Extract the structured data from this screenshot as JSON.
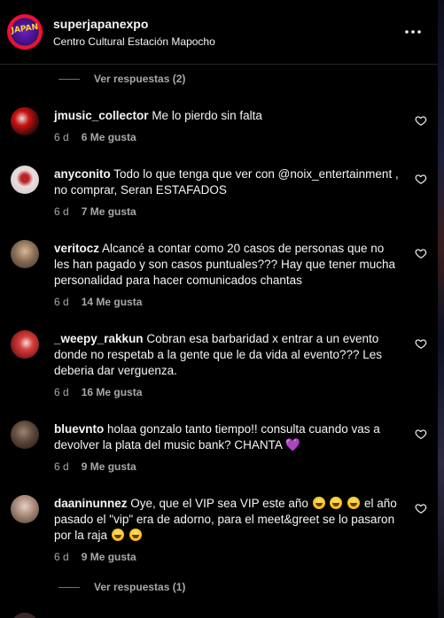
{
  "header": {
    "username": "superjapanexpo",
    "location": "Centro Cultural Estación Mapocho",
    "logo_text": "JAPAN",
    "more_icon": "more-horizontal-icon"
  },
  "replies_top": {
    "label": "Ver respuestas (2)"
  },
  "replies_bottom": {
    "label": "Ver respuestas (1)"
  },
  "comments": [
    {
      "username": "jmusic_collector",
      "text": "Me lo pierdo sin falta",
      "age": "6 d",
      "likes": "6 Me gusta",
      "avatar_color": "#5a1010"
    },
    {
      "username": "anyconito",
      "text": "Todo lo que tenga que ver con @noix_entertainment , no comprar, Seran ESTAFADOS",
      "age": "6 d",
      "likes": "7 Me gusta",
      "avatar_color": "#d8c8c8"
    },
    {
      "username": "veritocz",
      "text": "Alcancé a contar como 20 casos de personas que no les han pagado y son casos puntuales??? Hay que tener mucha personalidad para hacer comunicados chantas",
      "age": "6 d",
      "likes": "14 Me gusta",
      "avatar_color": "#6b5a4a"
    },
    {
      "username": "_weepy_rakkun",
      "text": "Cobran esa barbaridad x entrar a un evento donde no respetab a la gente que le da vida al evento??? Les deberia dar verguenza.",
      "age": "6 d",
      "likes": "16 Me gusta",
      "avatar_color": "#a82a2a"
    },
    {
      "username": "bluevnto",
      "text_before": "holaa gonzalo tanto tiempo!! consulta cuando vas a devolver la plata del music bank? CHANTA",
      "heart_emoji": "💜",
      "age": "6 d",
      "likes": "9 Me gusta",
      "avatar_color": "#4a3a30"
    },
    {
      "username": "daaninunnez",
      "text_a": "Oye, que el VIP sea VIP este año",
      "text_b": "el año pasado el \"vip\" era de adorno, para el meet&greet se lo pasaron por la raja",
      "age": "6 d",
      "likes": "9 Me gusta",
      "avatar_color": "#8a7060"
    }
  ],
  "colors": {
    "background": "#000000",
    "text": "#f5f5f5",
    "secondary_text": "#a8a8a8",
    "divider": "#262626"
  }
}
